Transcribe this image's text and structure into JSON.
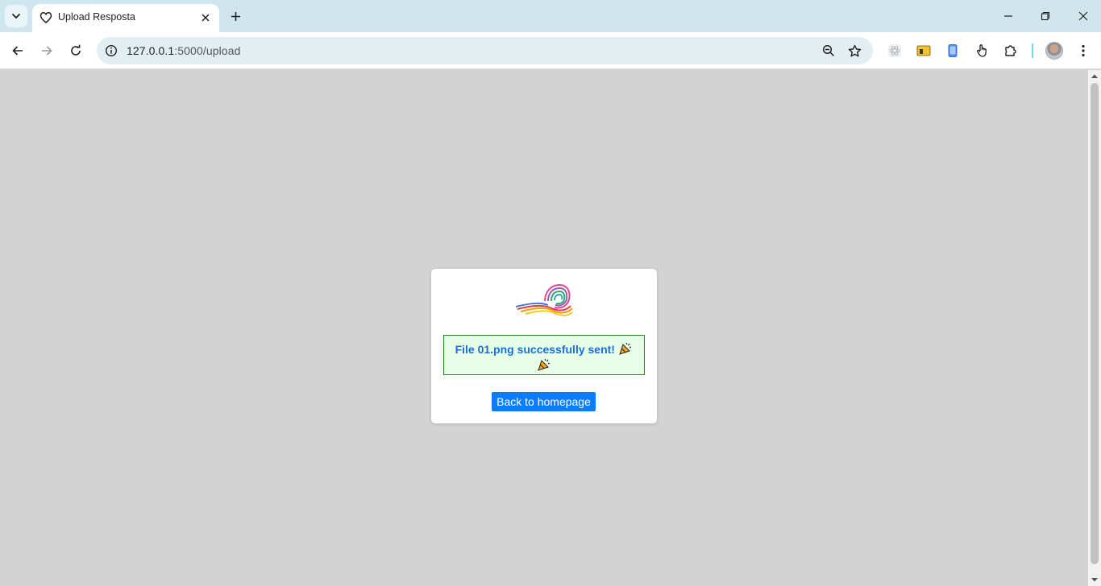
{
  "browser": {
    "tab_title": "Upload Resposta",
    "url_host": "127.0.0.1",
    "url_rest": ":5000/upload"
  },
  "page": {
    "message": "File 01.png successfully sent!",
    "back_button": "Back to homepage"
  },
  "icons": {
    "favicon": "heart-outline-icon",
    "party": "party-popper-icon"
  },
  "colors": {
    "page_bg": "#d3d3d3",
    "message_bg": "#e6ffe6",
    "message_border": "#1e8a1e",
    "message_text": "#1a6ed8",
    "button_bg": "#0a7cff"
  }
}
